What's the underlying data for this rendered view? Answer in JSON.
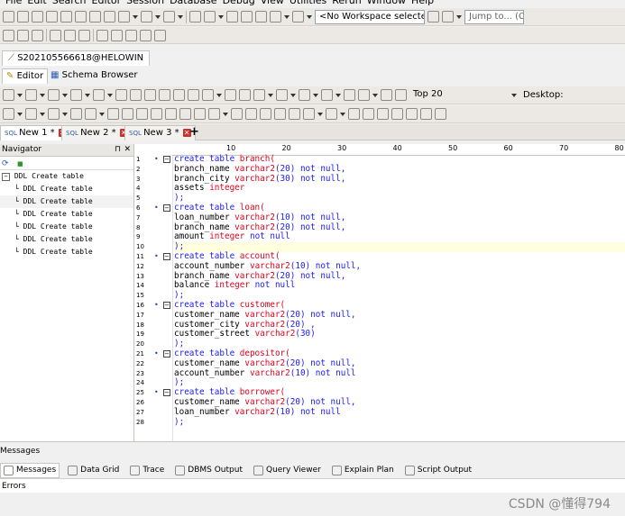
{
  "menu": {
    "items": [
      "File",
      "Edit",
      "Search",
      "Editor",
      "Session",
      "Database",
      "Debug",
      "View",
      "Utilities",
      "Rerun",
      "Window",
      "Help"
    ]
  },
  "toolbar": {
    "workspace": "<No Workspace selected>",
    "jump": "Jump to... (Ctrl+",
    "top20": "Top 20",
    "desktop": "Desktop:"
  },
  "connection": {
    "tab_label": "S202105566618@HELOWIN"
  },
  "views": {
    "editor": "Editor",
    "schema": "Schema Browser"
  },
  "doc_tabs": [
    {
      "label": "New 1 *"
    },
    {
      "label": "New 2 *"
    },
    {
      "label": "New 3 *"
    }
  ],
  "navigator": {
    "title": "Navigator",
    "root": "DDL Create table",
    "children": [
      "DDL Create table",
      "DDL Create table",
      "DDL Create table",
      "DDL Create table",
      "DDL Create table",
      "DDL Create table"
    ]
  },
  "ruler": {
    "marks": [
      "10",
      "20",
      "30",
      "40",
      "50",
      "60",
      "70",
      "80"
    ]
  },
  "code_lines": [
    [
      {
        "t": "create table ",
        "c": "kw"
      },
      {
        "t": "branch(",
        "c": "ty"
      }
    ],
    [
      {
        "t": "branch_name ",
        "c": ""
      },
      {
        "t": "varchar2",
        "c": "ty"
      },
      {
        "t": "(20) not null,",
        "c": "kw"
      }
    ],
    [
      {
        "t": "branch_city ",
        "c": ""
      },
      {
        "t": "varchar2",
        "c": "ty"
      },
      {
        "t": "(30) not null,",
        "c": "kw"
      }
    ],
    [
      {
        "t": "assets ",
        "c": ""
      },
      {
        "t": "integer",
        "c": "ty"
      }
    ],
    [
      {
        "t": ");",
        "c": "kw"
      }
    ],
    [
      {
        "t": "create table ",
        "c": "kw"
      },
      {
        "t": "loan(",
        "c": "ty"
      }
    ],
    [
      {
        "t": "loan_number ",
        "c": ""
      },
      {
        "t": "varchar2",
        "c": "ty"
      },
      {
        "t": "(10) not null,",
        "c": "kw"
      }
    ],
    [
      {
        "t": "branch_name ",
        "c": ""
      },
      {
        "t": "varchar2",
        "c": "ty"
      },
      {
        "t": "(20) not null,",
        "c": "kw"
      }
    ],
    [
      {
        "t": "amount ",
        "c": ""
      },
      {
        "t": "integer",
        "c": "ty"
      },
      {
        "t": " not null",
        "c": "kw"
      }
    ],
    [
      {
        "t": ");",
        "c": "kw"
      }
    ],
    [
      {
        "t": "create table ",
        "c": "kw"
      },
      {
        "t": "account(",
        "c": "ty"
      }
    ],
    [
      {
        "t": "account_number ",
        "c": ""
      },
      {
        "t": "varchar2",
        "c": "ty"
      },
      {
        "t": "(10) not null,",
        "c": "kw"
      }
    ],
    [
      {
        "t": "branch_name ",
        "c": ""
      },
      {
        "t": "varchar2",
        "c": "ty"
      },
      {
        "t": "(20) not null,",
        "c": "kw"
      }
    ],
    [
      {
        "t": "balance ",
        "c": ""
      },
      {
        "t": "integer",
        "c": "ty"
      },
      {
        "t": " not null",
        "c": "kw"
      }
    ],
    [
      {
        "t": ");",
        "c": "kw"
      }
    ],
    [
      {
        "t": "create table ",
        "c": "kw"
      },
      {
        "t": "customer(",
        "c": "ty"
      }
    ],
    [
      {
        "t": "customer_name ",
        "c": ""
      },
      {
        "t": "varchar2",
        "c": "ty"
      },
      {
        "t": "(20) not null,",
        "c": "kw"
      }
    ],
    [
      {
        "t": "customer_city ",
        "c": ""
      },
      {
        "t": "varchar2",
        "c": "ty"
      },
      {
        "t": "(20) ,",
        "c": "kw"
      }
    ],
    [
      {
        "t": "customer_street ",
        "c": ""
      },
      {
        "t": "varchar2",
        "c": "ty"
      },
      {
        "t": "(30)",
        "c": "kw"
      }
    ],
    [
      {
        "t": ");",
        "c": "kw"
      }
    ],
    [
      {
        "t": "create table ",
        "c": "kw"
      },
      {
        "t": "depositor(",
        "c": "ty"
      }
    ],
    [
      {
        "t": "customer_name ",
        "c": ""
      },
      {
        "t": "varchar2",
        "c": "ty"
      },
      {
        "t": "(20) not null,",
        "c": "kw"
      }
    ],
    [
      {
        "t": "account_number ",
        "c": ""
      },
      {
        "t": "varchar2",
        "c": "ty"
      },
      {
        "t": "(10) not null",
        "c": "kw"
      }
    ],
    [
      {
        "t": ");",
        "c": "kw"
      }
    ],
    [
      {
        "t": "create table ",
        "c": "kw"
      },
      {
        "t": "borrower(",
        "c": "ty"
      }
    ],
    [
      {
        "t": "customer_name ",
        "c": ""
      },
      {
        "t": "varchar2",
        "c": "ty"
      },
      {
        "t": "(20) not null,",
        "c": "kw"
      }
    ],
    [
      {
        "t": "loan_number ",
        "c": ""
      },
      {
        "t": "varchar2",
        "c": "ty"
      },
      {
        "t": "(10) not null",
        "c": "kw"
      }
    ],
    [
      {
        "t": ");",
        "c": "kw"
      }
    ]
  ],
  "fold_lines": [
    1,
    6,
    11,
    16,
    21,
    25
  ],
  "highlight_line": 10,
  "messages": {
    "title": "Messages",
    "tabs": [
      "Messages",
      "Data Grid",
      "Trace",
      "DBMS Output",
      "Query Viewer",
      "Explain Plan",
      "Script Output"
    ],
    "errors_label": "Errors"
  },
  "watermark": "CSDN @懂得794"
}
